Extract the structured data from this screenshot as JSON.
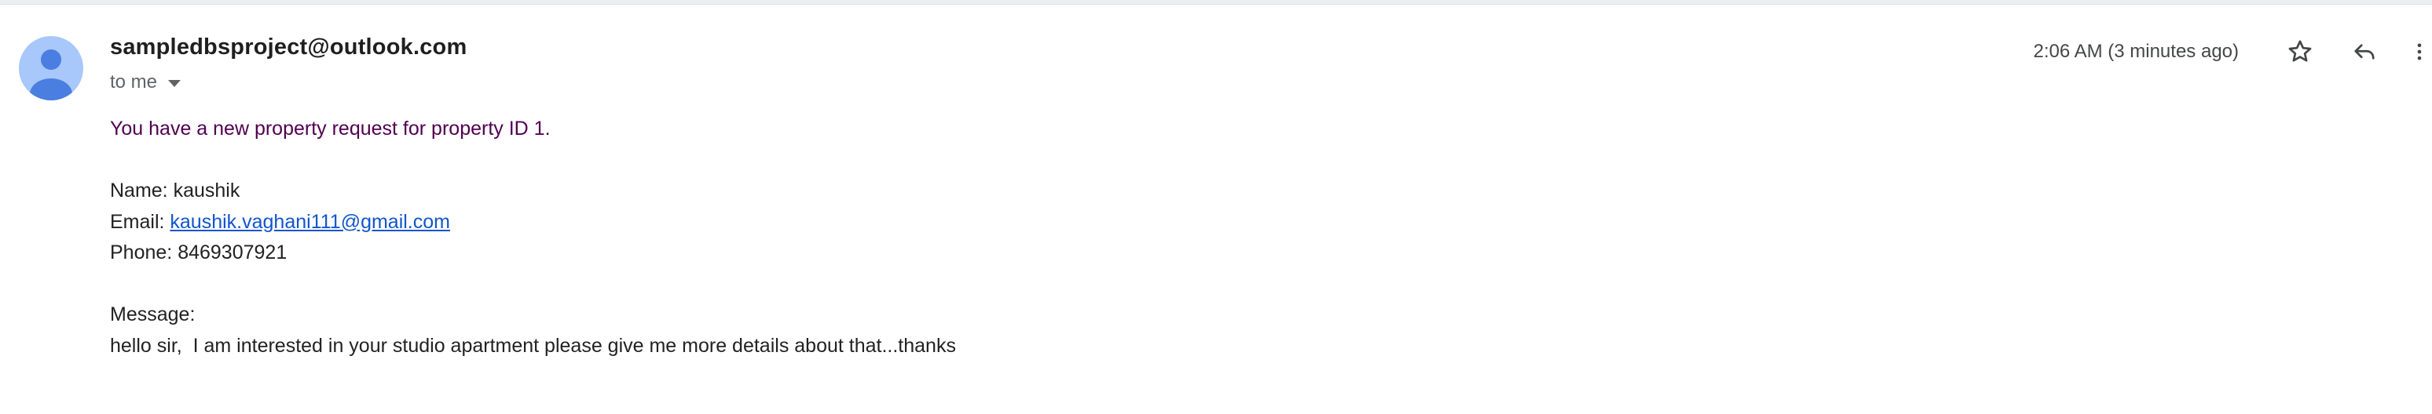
{
  "header": {
    "sender": "sampledbsproject@outlook.com",
    "recipient_label": "to me",
    "timestamp": "2:06 AM (3 minutes ago)",
    "avatar_icon": "person-avatar-icon",
    "avatar_color": "#a8c7fa",
    "avatar_figure_color": "#4a7ee0",
    "actions": {
      "star_icon": "star-outline-icon",
      "reply_icon": "reply-icon",
      "more_icon": "more-vert-icon"
    }
  },
  "message": {
    "intro": "You have a new property request for property ID 1.",
    "name_label": "Name: ",
    "name_value": "kaushik",
    "email_label": "Email: ",
    "email_value": "kaushik.vaghani111@gmail.com",
    "phone_label": "Phone: ",
    "phone_value": "8469307921",
    "message_label": "Message:",
    "message_text": "hello sir,  I am interested in your studio apartment please give me more details about that...thanks"
  },
  "colors": {
    "intro_text": "#500050",
    "link": "#1155cc",
    "meta_text": "#5f6368"
  }
}
